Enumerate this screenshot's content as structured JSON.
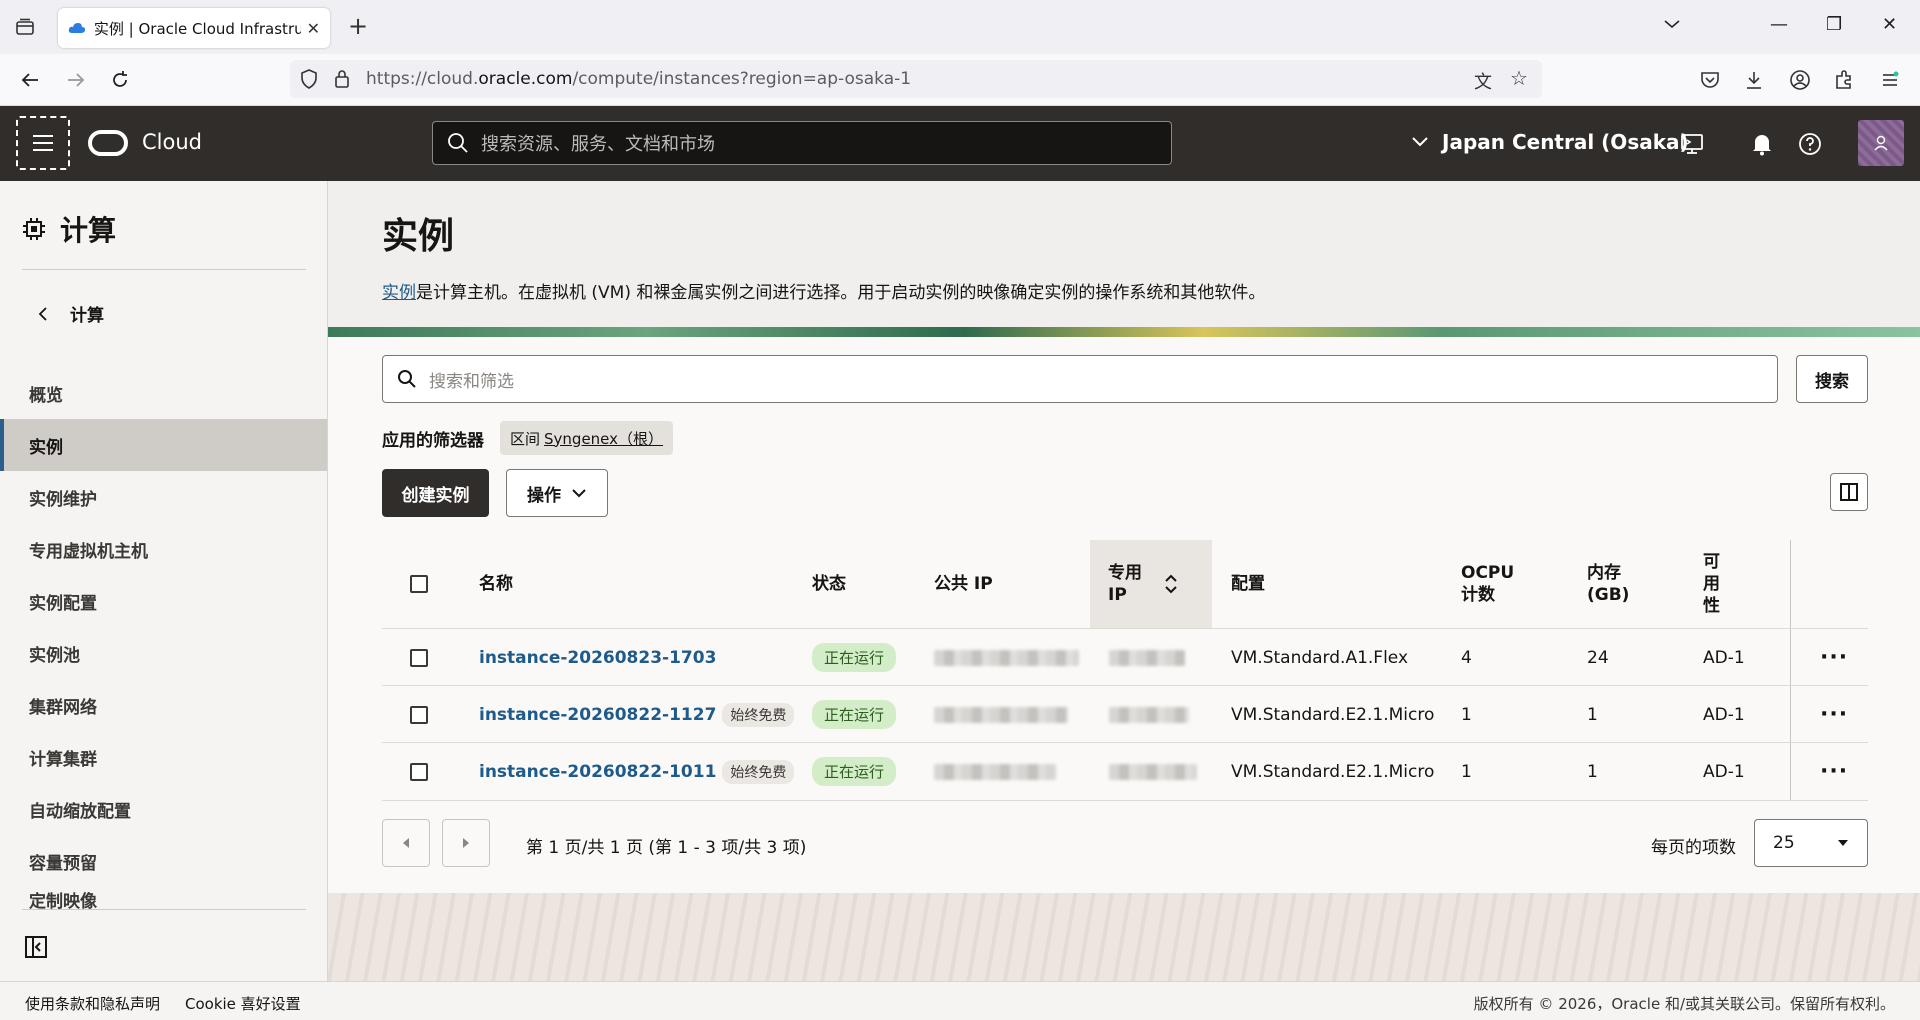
{
  "browser": {
    "tab_title": "实例 | Oracle Cloud Infrastruc",
    "url_prefix": "https://cloud.",
    "url_host": "oracle.com",
    "url_path": "/compute/instances?region=ap-osaka-1"
  },
  "header": {
    "logo_text": "Cloud",
    "search_placeholder": "搜索资源、服务、文档和市场",
    "region": "Japan Central (Osaka)"
  },
  "sidebar": {
    "title": "计算",
    "back_label": "计算",
    "items": [
      {
        "label": "概览"
      },
      {
        "label": "实例"
      },
      {
        "label": "实例维护"
      },
      {
        "label": "专用虚拟机主机"
      },
      {
        "label": "实例配置"
      },
      {
        "label": "实例池"
      },
      {
        "label": "集群网络"
      },
      {
        "label": "计算集群"
      },
      {
        "label": "自动缩放配置"
      },
      {
        "label": "容量预留"
      },
      {
        "label": "定制映像"
      }
    ]
  },
  "page": {
    "title": "实例",
    "desc_link": "实例",
    "desc_text": "是计算主机。在虚拟机 (VM) 和裸金属实例之间进行选择。用于启动实例的映像确定实例的操作系统和其他软件。",
    "filter_placeholder": "搜索和筛选",
    "search_button": "搜索",
    "applied_filters_label": "应用的筛选器",
    "chip_key": "区间",
    "chip_value": "Syngenex（根）",
    "create_button": "创建实例",
    "actions_button": "操作"
  },
  "table": {
    "columns": {
      "name": "名称",
      "status": "状态",
      "public_ip": "公共 IP",
      "private_ip_1": "专用",
      "private_ip_2": "IP",
      "shape": "配置",
      "ocpu_1": "OCPU",
      "ocpu_2": "计数",
      "memory_1": "内存",
      "memory_2": "(GB)",
      "ad_1": "可",
      "ad_2": "用",
      "ad_3": "性"
    },
    "rows": [
      {
        "name": "instance-20260823-1703",
        "badge": "",
        "status": "正在运行",
        "shape": "VM.Standard.A1.Flex",
        "ocpu": "4",
        "memory": "24",
        "ad": "AD-1"
      },
      {
        "name": "instance-20260822-1127",
        "badge": "始终免费",
        "status": "正在运行",
        "shape": "VM.Standard.E2.1.Micro",
        "ocpu": "1",
        "memory": "1",
        "ad": "AD-1"
      },
      {
        "name": "instance-20260822-1011",
        "badge": "始终免费",
        "status": "正在运行",
        "shape": "VM.Standard.E2.1.Micro",
        "ocpu": "1",
        "memory": "1",
        "ad": "AD-1"
      }
    ]
  },
  "pagination": {
    "text": "第 1 页/共 1 页 (第 1 - 3 项/共 3 项)",
    "per_page_label": "每页的项数",
    "per_page_value": "25"
  },
  "footer": {
    "terms": "使用条款和隐私声明",
    "cookie": "Cookie 喜好设置",
    "copyright": "版权所有 © 2026，Oracle 和/或其关联公司。保留所有权利。"
  },
  "colors": {
    "header_bg": "#312d2a",
    "link": "#1f5b8a",
    "status_bg": "#d4edc9"
  }
}
